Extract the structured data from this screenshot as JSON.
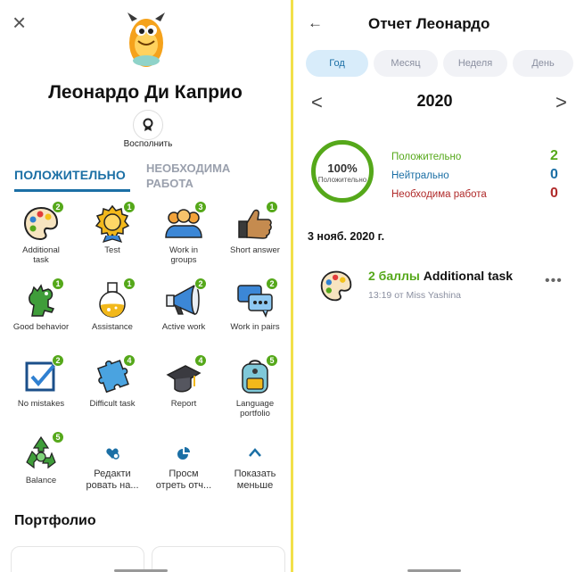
{
  "left": {
    "close_glyph": "×",
    "student_name": "Леонардо Ди Каприо",
    "redeem_label": "Восполнить",
    "tabs": {
      "positive": "ПОЛОЖИТЕЛЬНО",
      "needs_work_line1": "НЕОБХОДИМА",
      "needs_work_line2": "РАБОТА"
    },
    "skills": [
      {
        "label_1": "Additional",
        "label_2": "task",
        "count": "2",
        "icon": "palette-icon"
      },
      {
        "label_1": "Test",
        "label_2": "",
        "count": "1",
        "icon": "medal-icon"
      },
      {
        "label_1": "Work in",
        "label_2": "groups",
        "count": "3",
        "icon": "group-icon"
      },
      {
        "label_1": "Short answer",
        "label_2": "",
        "count": "1",
        "icon": "thumbs-up-icon"
      },
      {
        "label_1": "Good behavior",
        "label_2": "",
        "count": "1",
        "icon": "dinosaur-icon"
      },
      {
        "label_1": "Assistance",
        "label_2": "",
        "count": "1",
        "icon": "flask-icon"
      },
      {
        "label_1": "Active work",
        "label_2": "",
        "count": "2",
        "icon": "megaphone-icon"
      },
      {
        "label_1": "Work in pairs",
        "label_2": "",
        "count": "2",
        "icon": "chat-bubbles-icon"
      },
      {
        "label_1": "No mistakes",
        "label_2": "",
        "count": "2",
        "icon": "checkbox-icon"
      },
      {
        "label_1": "Difficult task",
        "label_2": "",
        "count": "4",
        "icon": "puzzle-icon"
      },
      {
        "label_1": "Report",
        "label_2": "",
        "count": "4",
        "icon": "graduation-cap-icon"
      },
      {
        "label_1": "Language",
        "label_2": "portfolio",
        "count": "5",
        "icon": "backpack-icon"
      },
      {
        "label_1": "Balance",
        "label_2": "",
        "count": "5",
        "icon": "recycle-icon"
      }
    ],
    "actions": {
      "edit_1": "Редакти",
      "edit_2": "ровать на...",
      "view_1": "Просм",
      "view_2": "отреть отч...",
      "less_1": "Показать",
      "less_2": "меньше"
    },
    "portfolio_title": "Портфолио"
  },
  "right": {
    "back_glyph": "←",
    "title": "Отчет Леонардо",
    "periods": [
      "Год",
      "Месяц",
      "Неделя",
      "День"
    ],
    "active_period": "Год",
    "prev_glyph": "<",
    "year": "2020",
    "next_glyph": ">",
    "percent": "100%",
    "percent_label": "Положительно",
    "positive_fraction": 1.0,
    "stats": {
      "positive_label": "Положительно",
      "positive_value": "2",
      "neutral_label": "Нейтрально",
      "neutral_value": "0",
      "needs_work_label": "Необходима работа",
      "needs_work_value": "0"
    },
    "date_heading": "3 нояб. 2020 г.",
    "entry": {
      "points": "2 баллы",
      "skill": "Additional task",
      "meta": "13:19 от Miss Yashina",
      "more": "•••"
    }
  },
  "colors": {
    "brand_blue": "#1b6fa5",
    "positive_green": "#55a81a",
    "neutral_blue": "#1b6fa5",
    "needs_work_red": "#b02a2a",
    "divider_yellow": "#f2e04a"
  }
}
